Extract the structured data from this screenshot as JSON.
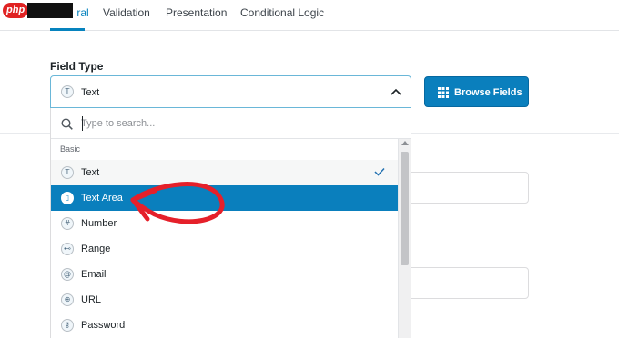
{
  "tabs": {
    "general": "General",
    "validation": "Validation",
    "presentation": "Presentation",
    "conditional": "Conditional Logic"
  },
  "watermark": "php",
  "field_type": {
    "label": "Field Type",
    "selected_value": "Text",
    "selected_icon": "T",
    "browse_label": "Browse Fields"
  },
  "dropdown": {
    "search_placeholder": "Type to search...",
    "group_label": "Basic",
    "options": [
      {
        "label": "Text",
        "icon": "T"
      },
      {
        "label": "Text Area",
        "icon": "▯"
      },
      {
        "label": "Number",
        "icon": "#"
      },
      {
        "label": "Range",
        "icon": "⊷"
      },
      {
        "label": "Email",
        "icon": "@"
      },
      {
        "label": "URL",
        "icon": "⊕"
      },
      {
        "label": "Password",
        "icon": "⚷"
      }
    ]
  },
  "colors": {
    "accent": "#0a7fbd",
    "annotation_arrow": "#e5202a"
  }
}
